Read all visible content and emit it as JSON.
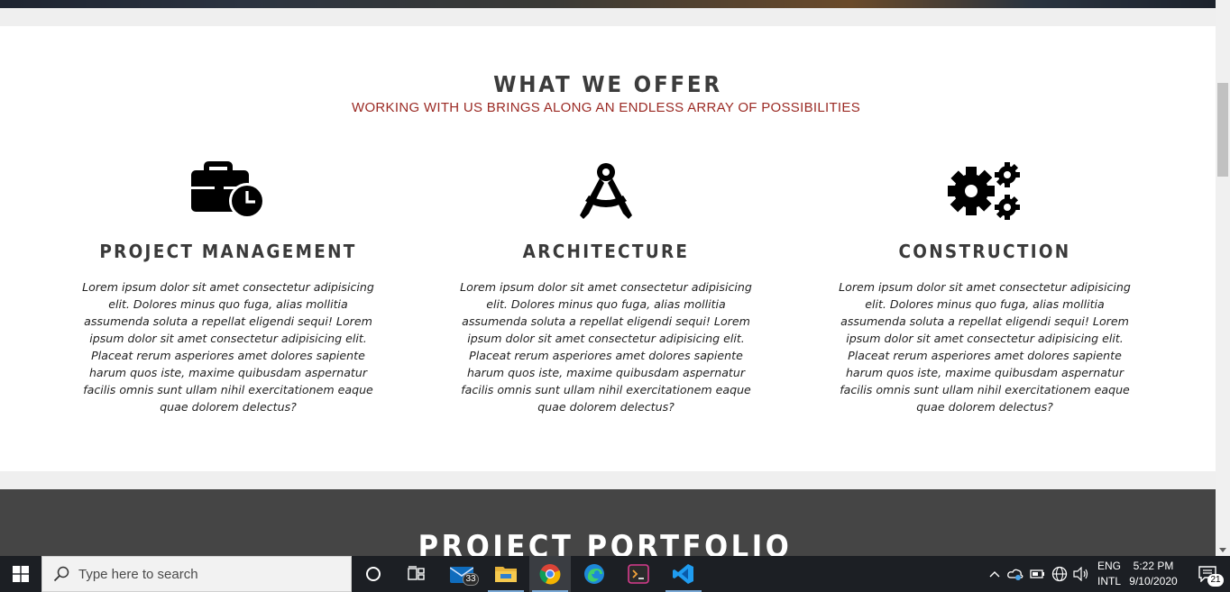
{
  "offer": {
    "title": "WHAT WE OFFER",
    "subtitle": "WORKING WITH US BRINGS ALONG AN ENDLESS ARRAY OF POSSIBILITIES",
    "accent_color": "#9b2a24",
    "services": [
      {
        "icon": "briefcase-clock-icon",
        "title": "PROJECT MANAGEMENT",
        "text": "Lorem ipsum dolor sit amet consectetur adipisicing elit. Dolores minus quo fuga, alias mollitia assumenda soluta a repellat eligendi sequi! Lorem ipsum dolor sit amet consectetur adipisicing elit. Placeat rerum asperiores amet dolores sapiente harum quos iste, maxime quibusdam aspernatur facilis omnis sunt ullam nihil exercitationem eaque quae dolorem delectus?"
      },
      {
        "icon": "drafting-compass-icon",
        "title": "ARCHITECTURE",
        "text": "Lorem ipsum dolor sit amet consectetur adipisicing elit. Dolores minus quo fuga, alias mollitia assumenda soluta a repellat eligendi sequi! Lorem ipsum dolor sit amet consectetur adipisicing elit. Placeat rerum asperiores amet dolores sapiente harum quos iste, maxime quibusdam aspernatur facilis omnis sunt ullam nihil exercitationem eaque quae dolorem delectus?"
      },
      {
        "icon": "cogs-icon",
        "title": "CONSTRUCTION",
        "text": "Lorem ipsum dolor sit amet consectetur adipisicing elit. Dolores minus quo fuga, alias mollitia assumenda soluta a repellat eligendi sequi! Lorem ipsum dolor sit amet consectetur adipisicing elit. Placeat rerum asperiores amet dolores sapiente harum quos iste, maxime quibusdam aspernatur facilis omnis sunt ullam nihil exercitationem eaque quae dolorem delectus?"
      }
    ]
  },
  "portfolio": {
    "title": "PROJECT PORTFOLIO",
    "background": "#454545"
  },
  "taskbar": {
    "search_placeholder": "Type here to search",
    "apps": [
      {
        "name": "cortana-icon"
      },
      {
        "name": "task-view-icon"
      },
      {
        "name": "mail-icon",
        "badge": "33"
      },
      {
        "name": "file-explorer-icon"
      },
      {
        "name": "chrome-icon"
      },
      {
        "name": "edge-icon"
      },
      {
        "name": "terminal-icon"
      },
      {
        "name": "vscode-icon"
      }
    ],
    "language": {
      "line1": "ENG",
      "line2": "INTL"
    },
    "clock": {
      "time": "5:22 PM",
      "date": "9/10/2020"
    },
    "notifications_badge": "21"
  }
}
